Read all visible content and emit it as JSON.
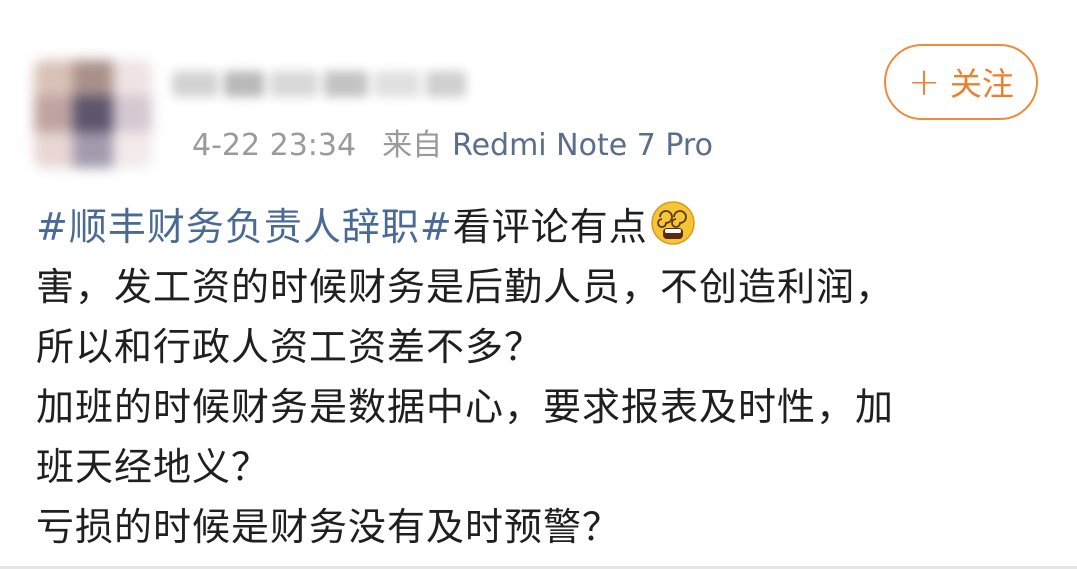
{
  "post": {
    "timestamp": "4-22 23:34",
    "source_prefix": "来自",
    "source_device": "Redmi Note 7 Pro",
    "follow_button": {
      "icon": "plus-icon",
      "label": "关注"
    },
    "content": {
      "hashtag": "#顺丰财务负责人辞职#",
      "lead_text": "看评论有点",
      "emoji": "dizzy-face-emoji",
      "lines": [
        "害，发工资的时候财务是后勤人员，不创造利润，",
        "所以和行政人资工资差不多？",
        "加班的时候财务是数据中心，要求报表及时性，加",
        "班天经地义？",
        "亏损的时候是财务没有及时预警？"
      ]
    }
  },
  "colors": {
    "accent_orange": "#ef7f2a",
    "hashtag_blue": "#4a6a96",
    "meta_gray": "#9a9a9a",
    "device_blue": "#5a6d8c"
  }
}
